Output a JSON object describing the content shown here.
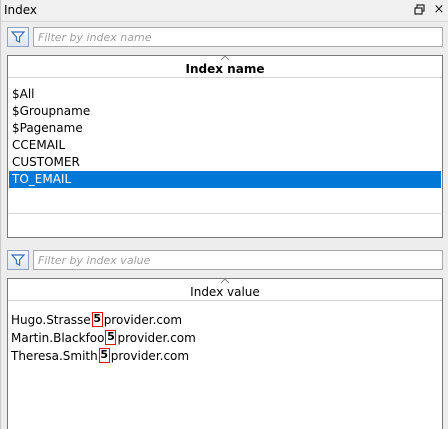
{
  "panel": {
    "title": "Index",
    "pin_icon": "pin-icon",
    "close_glyph": "×"
  },
  "index_filter": {
    "placeholder": "Filter by index name",
    "value": ""
  },
  "index_names": {
    "header": "Index name",
    "items": [
      {
        "label": "$All",
        "selected": false
      },
      {
        "label": "$Groupname",
        "selected": false
      },
      {
        "label": "$Pagename",
        "selected": false
      },
      {
        "label": "CCEMAIL",
        "selected": false
      },
      {
        "label": "CUSTOMER",
        "selected": false
      },
      {
        "label": "TO_EMAIL",
        "selected": true
      }
    ]
  },
  "value_filter": {
    "placeholder": "Filter by index value",
    "value": ""
  },
  "index_values": {
    "header": "Index value",
    "at_glyph": "5",
    "items": [
      {
        "local": "Hugo.Strasse",
        "domain": "provider.com"
      },
      {
        "local": "Martin.Blackfoo",
        "domain": "provider.com"
      },
      {
        "local": "Theresa.Smith",
        "domain": "provider.com"
      }
    ]
  },
  "colors": {
    "selection": "#0078d7",
    "at_marker_border": "#e01010"
  }
}
